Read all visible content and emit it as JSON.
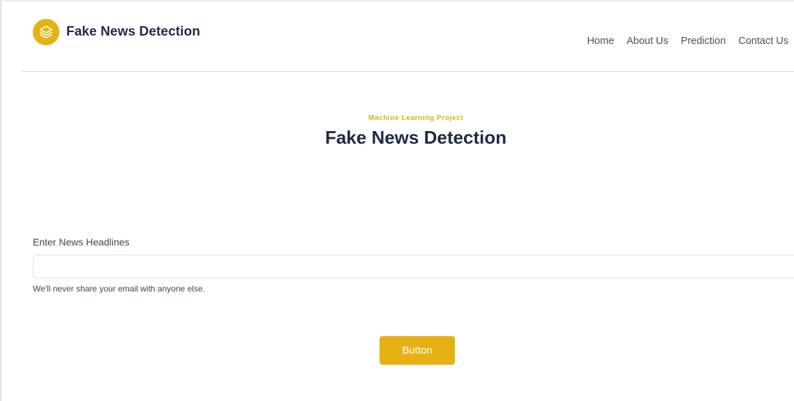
{
  "header": {
    "brand": {
      "icon": "layers-icon",
      "name": "Fake News Detection"
    },
    "nav": {
      "home": "Home",
      "about": "About Us",
      "prediction": "Prediction",
      "contact": "Contact Us"
    }
  },
  "hero": {
    "subtitle": "Machine Learning Project",
    "title": "Fake News Detection"
  },
  "form": {
    "label": "Enter News Headlines",
    "value": "",
    "help": "We'll never share your email with anyone else.",
    "button": "Button"
  },
  "colors": {
    "accent": "#e6b112",
    "heading": "#1f2a44",
    "text": "#3c4655",
    "divider": "#dcdcdc"
  }
}
